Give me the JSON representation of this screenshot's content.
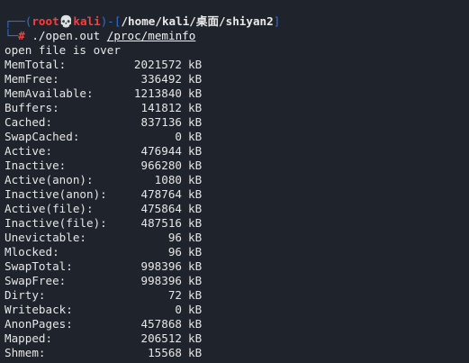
{
  "prompt": {
    "open_bracket": "┌──(",
    "user": "root",
    "skull": "💀",
    "host": "kali",
    "mid": ")-[",
    "path": "/home/kali/桌面/shiyan2",
    "close_bracket": "]",
    "branch": "└─",
    "hash": "#",
    "command": " ./open.out ",
    "argument": "/proc/meminfo"
  },
  "output_message": "open file is over",
  "meminfo": [
    {
      "key": "MemTotal:",
      "value": "2021572",
      "unit": "kB"
    },
    {
      "key": "MemFree:",
      "value": "336492",
      "unit": "kB"
    },
    {
      "key": "MemAvailable:",
      "value": "1213840",
      "unit": "kB"
    },
    {
      "key": "Buffers:",
      "value": "141812",
      "unit": "kB"
    },
    {
      "key": "Cached:",
      "value": "837136",
      "unit": "kB"
    },
    {
      "key": "SwapCached:",
      "value": "0",
      "unit": "kB"
    },
    {
      "key": "Active:",
      "value": "476944",
      "unit": "kB"
    },
    {
      "key": "Inactive:",
      "value": "966280",
      "unit": "kB"
    },
    {
      "key": "Active(anon):",
      "value": "1080",
      "unit": "kB"
    },
    {
      "key": "Inactive(anon):",
      "value": "478764",
      "unit": "kB"
    },
    {
      "key": "Active(file):",
      "value": "475864",
      "unit": "kB"
    },
    {
      "key": "Inactive(file):",
      "value": "487516",
      "unit": "kB"
    },
    {
      "key": "Unevictable:",
      "value": "96",
      "unit": "kB"
    },
    {
      "key": "Mlocked:",
      "value": "96",
      "unit": "kB"
    },
    {
      "key": "SwapTotal:",
      "value": "998396",
      "unit": "kB"
    },
    {
      "key": "SwapFree:",
      "value": "998396",
      "unit": "kB"
    },
    {
      "key": "Dirty:",
      "value": "72",
      "unit": "kB"
    },
    {
      "key": "Writeback:",
      "value": "0",
      "unit": "kB"
    },
    {
      "key": "AnonPages:",
      "value": "457868",
      "unit": "kB"
    },
    {
      "key": "Mapped:",
      "value": "206512",
      "unit": "kB"
    },
    {
      "key": "Shmem:",
      "value": "15568",
      "unit": "kB"
    }
  ],
  "colors": {
    "background": "#1f232b",
    "prompt_blue": "#2f6fd6",
    "prompt_red": "#ff3b3b"
  }
}
